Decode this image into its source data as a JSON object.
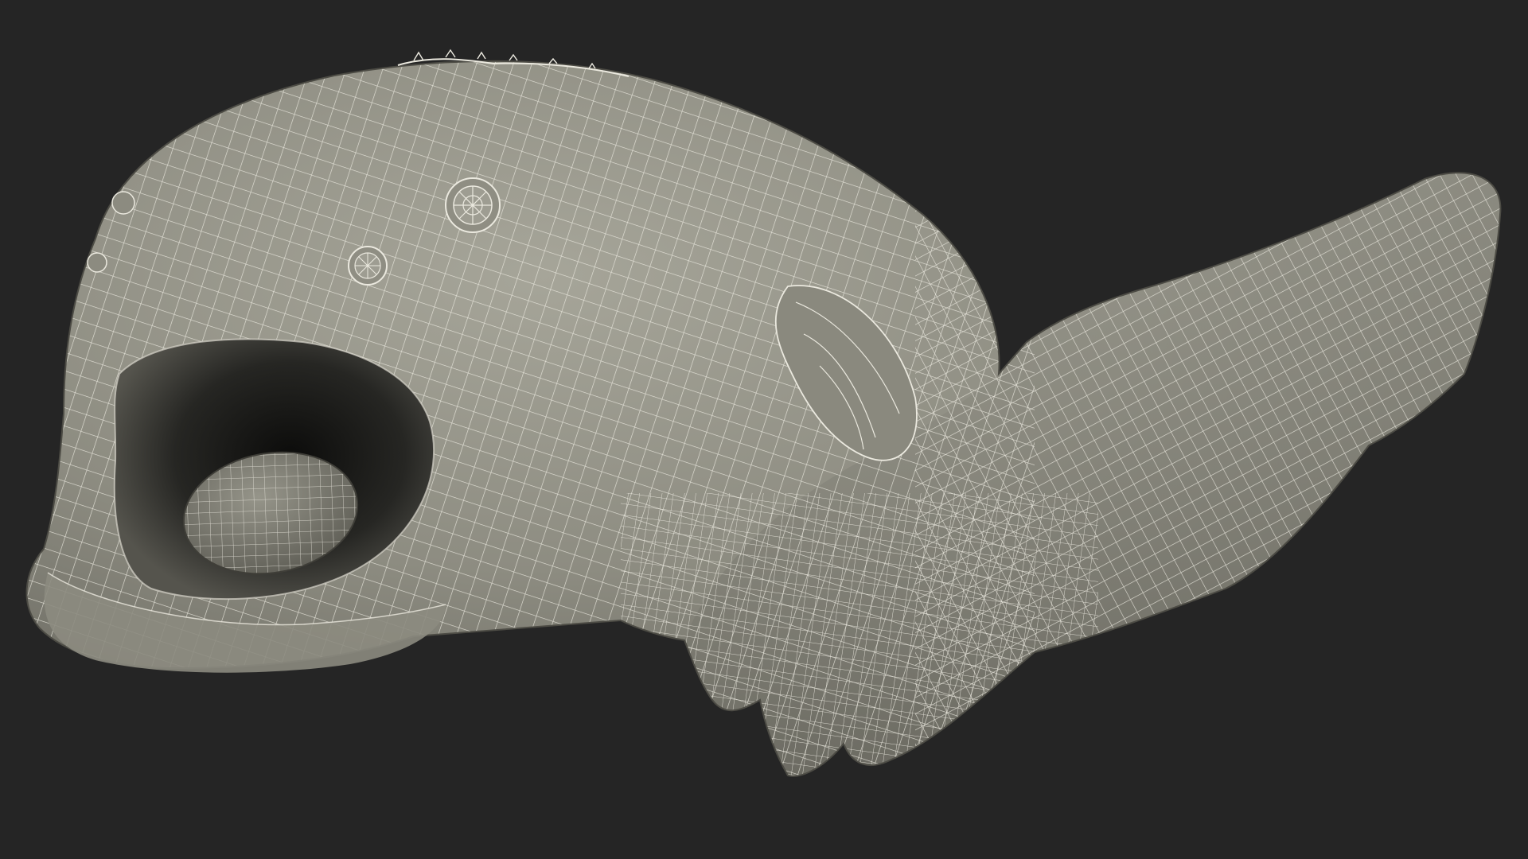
{
  "scene": {
    "subject": "wireframe-creature",
    "render_mode": "wireframe-over-clay"
  },
  "colors": {
    "background": "#252525",
    "surface": "#8f8e83",
    "surface_light": "#a3a296",
    "surface_dark": "#6b6a61",
    "mouth_cavity": "#1a1a18",
    "tongue": "#7f7e74",
    "wire": "#e8e6dc"
  },
  "icons": {
    "eye_left": "eye-icon",
    "eye_right": "eye-icon"
  }
}
